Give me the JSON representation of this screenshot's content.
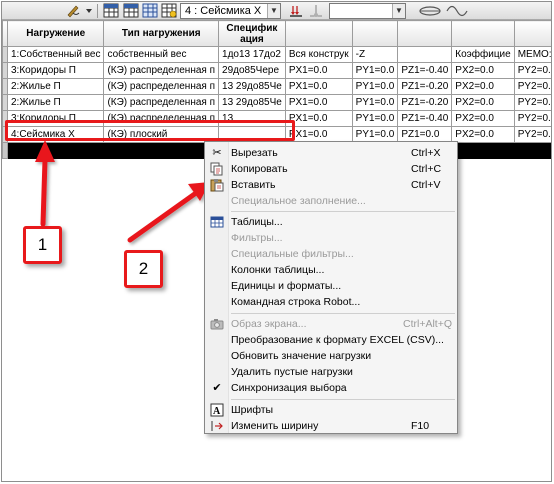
{
  "toolbar": {
    "case_combo": "4 : Сейсмика X"
  },
  "table": {
    "columns": [
      "Нагружение",
      "Тип нагружения",
      "Специфик\nация",
      "",
      "",
      "",
      "",
      "",
      ""
    ],
    "rows": [
      [
        "1:Собственный вес",
        "собственный вес",
        "1до13 17до2",
        "Вся конструк",
        "-Z",
        "",
        "Коэффицие",
        "МЕМО:",
        ""
      ],
      [
        "3:Коридоры П",
        "(КЭ) распределенная п",
        "29до85Чере",
        "PX1=0.0",
        "PY1=0.0",
        "PZ1=-0.40",
        "PX2=0.0",
        "PY2=0.0",
        ""
      ],
      [
        "2:Жилье П",
        "(КЭ) распределенная п",
        "13 29до85Че",
        "PX1=0.0",
        "PY1=0.0",
        "PZ1=-0.20",
        "PX2=0.0",
        "PY2=0.0",
        ""
      ],
      [
        "2:Жилье П",
        "(КЭ) распределенная п",
        "13 29до85Че",
        "PX1=0.0",
        "PY1=0.0",
        "PZ1=-0.20",
        "PX2=0.0",
        "PY2=0.0",
        ""
      ],
      [
        "3:Коридоры П",
        "(КЭ) распределенная п",
        "13",
        "PX1=0.0",
        "PY1=0.0",
        "PZ1=-0.40",
        "PX2=0.0",
        "PY2=0.0",
        ""
      ],
      [
        "4:Сейсмика X",
        "(КЭ) плоский",
        "",
        "PX1=0.0",
        "PY1=0.0",
        "PZ1=0.0",
        "PX2=0.0",
        "PY2=0.0",
        ""
      ]
    ]
  },
  "callouts": [
    "1",
    "2"
  ],
  "context_menu": {
    "items": [
      {
        "label": "Вырезать",
        "shortcut": "Ctrl+X",
        "icon": "scissors-icon",
        "disabled": false
      },
      {
        "label": "Копировать",
        "shortcut": "Ctrl+C",
        "icon": "copy-icon",
        "disabled": false
      },
      {
        "label": "Вставить",
        "shortcut": "Ctrl+V",
        "icon": "paste-icon",
        "disabled": false
      },
      {
        "label": "Специальное заполнение...",
        "shortcut": "",
        "icon": "",
        "disabled": true
      },
      {
        "label": "Таблицы...",
        "shortcut": "",
        "icon": "tables-icon",
        "disabled": false
      },
      {
        "label": "Фильтры...",
        "shortcut": "",
        "icon": "",
        "disabled": true
      },
      {
        "label": "Специальные фильтры...",
        "shortcut": "",
        "icon": "",
        "disabled": true
      },
      {
        "label": "Колонки таблицы...",
        "shortcut": "",
        "icon": "",
        "disabled": false
      },
      {
        "label": "Единицы и форматы...",
        "shortcut": "",
        "icon": "",
        "disabled": false
      },
      {
        "label": "Командная строка Robot...",
        "shortcut": "",
        "icon": "",
        "disabled": false
      },
      {
        "label": "Образ экрана...",
        "shortcut": "Ctrl+Alt+Q",
        "icon": "camera-icon",
        "disabled": true
      },
      {
        "label": "Преобразование к формату EXCEL (CSV)...",
        "shortcut": "",
        "icon": "",
        "disabled": false
      },
      {
        "label": "Обновить значение нагрузки",
        "shortcut": "",
        "icon": "",
        "disabled": false
      },
      {
        "label": "Удалить пустые нагрузки",
        "shortcut": "",
        "icon": "",
        "disabled": false
      },
      {
        "label": "Синхронизация выбора",
        "shortcut": "",
        "icon": "checkmark-icon",
        "disabled": false
      },
      {
        "label": "Шрифты",
        "shortcut": "",
        "icon": "fonts-icon",
        "disabled": false
      },
      {
        "label": "Изменить ширину",
        "shortcut": "F10",
        "icon": "resize-width-icon",
        "disabled": false
      }
    ]
  },
  "colors": {
    "highlight": "#e8191b",
    "selected_row": "#000000"
  }
}
